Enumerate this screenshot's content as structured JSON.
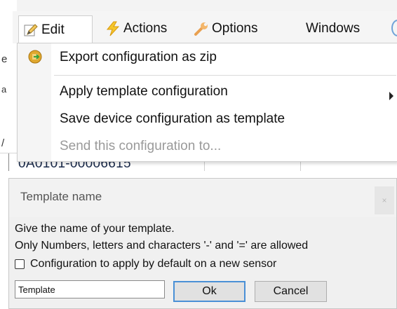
{
  "menubar": {
    "tabs": [
      {
        "label": "Edit",
        "icon": "pencil-icon"
      },
      {
        "label": "Actions",
        "icon": "lightning-icon"
      },
      {
        "label": "Options",
        "icon": "wrench-icon"
      },
      {
        "label": "Windows",
        "icon": ""
      }
    ]
  },
  "background": {
    "row_text": "0A0101-00006615",
    "left_fragments": [
      "e",
      "a",
      "/"
    ]
  },
  "edit_menu": {
    "items": [
      {
        "label": "Export configuration as zip",
        "icon": "zip-export-icon",
        "enabled": true
      },
      {
        "label": "Apply template configuration",
        "submenu": true,
        "enabled": true
      },
      {
        "label": "Save device configuration as template",
        "enabled": true
      },
      {
        "label": "Send this configuration to...",
        "enabled": false
      }
    ]
  },
  "dialog": {
    "title": "Template name",
    "close_label": "×",
    "line1": "Give the name of your template.",
    "line2": "Only Numbers, letters and characters '-' and '=' are allowed",
    "checkbox_label": "Configuration to apply by default on a new sensor",
    "checkbox_checked": false,
    "name_value": "Template",
    "ok_label": "Ok",
    "cancel_label": "Cancel"
  },
  "colors": {
    "accent_focus": "#4a90d6",
    "disabled_text": "#9a9a9a"
  }
}
